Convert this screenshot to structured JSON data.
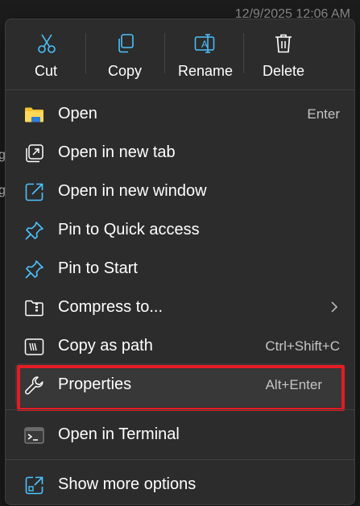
{
  "background": {
    "date_text": "12/9/2025 12:06 AM",
    "fragments": [
      "g",
      "g"
    ]
  },
  "quick_actions": [
    {
      "label": "Cut",
      "icon": "scissors-icon"
    },
    {
      "label": "Copy",
      "icon": "copy-icon"
    },
    {
      "label": "Rename",
      "icon": "rename-icon"
    },
    {
      "label": "Delete",
      "icon": "trash-icon"
    }
  ],
  "menu_items": [
    {
      "label": "Open",
      "shortcut": "Enter",
      "icon": "folder-icon"
    },
    {
      "label": "Open in new tab",
      "shortcut": "",
      "icon": "new-tab-icon"
    },
    {
      "label": "Open in new window",
      "shortcut": "",
      "icon": "new-window-icon"
    },
    {
      "label": "Pin to Quick access",
      "shortcut": "",
      "icon": "pin-icon"
    },
    {
      "label": "Pin to Start",
      "shortcut": "",
      "icon": "pin-icon"
    },
    {
      "label": "Compress to...",
      "shortcut": "",
      "icon": "archive-folder-icon",
      "submenu": true
    },
    {
      "label": "Copy as path",
      "shortcut": "Ctrl+Shift+C",
      "icon": "copy-path-icon"
    },
    {
      "label": "Properties",
      "shortcut": "Alt+Enter",
      "icon": "wrench-icon"
    },
    {
      "label": "Open in Terminal",
      "shortcut": "",
      "icon": "terminal-icon"
    },
    {
      "label": "Show more options",
      "shortcut": "",
      "icon": "more-options-icon"
    }
  ],
  "colors": {
    "accent": "#4cc2ff",
    "highlight": "#e51b23",
    "menu_bg": "#2c2c2c"
  }
}
